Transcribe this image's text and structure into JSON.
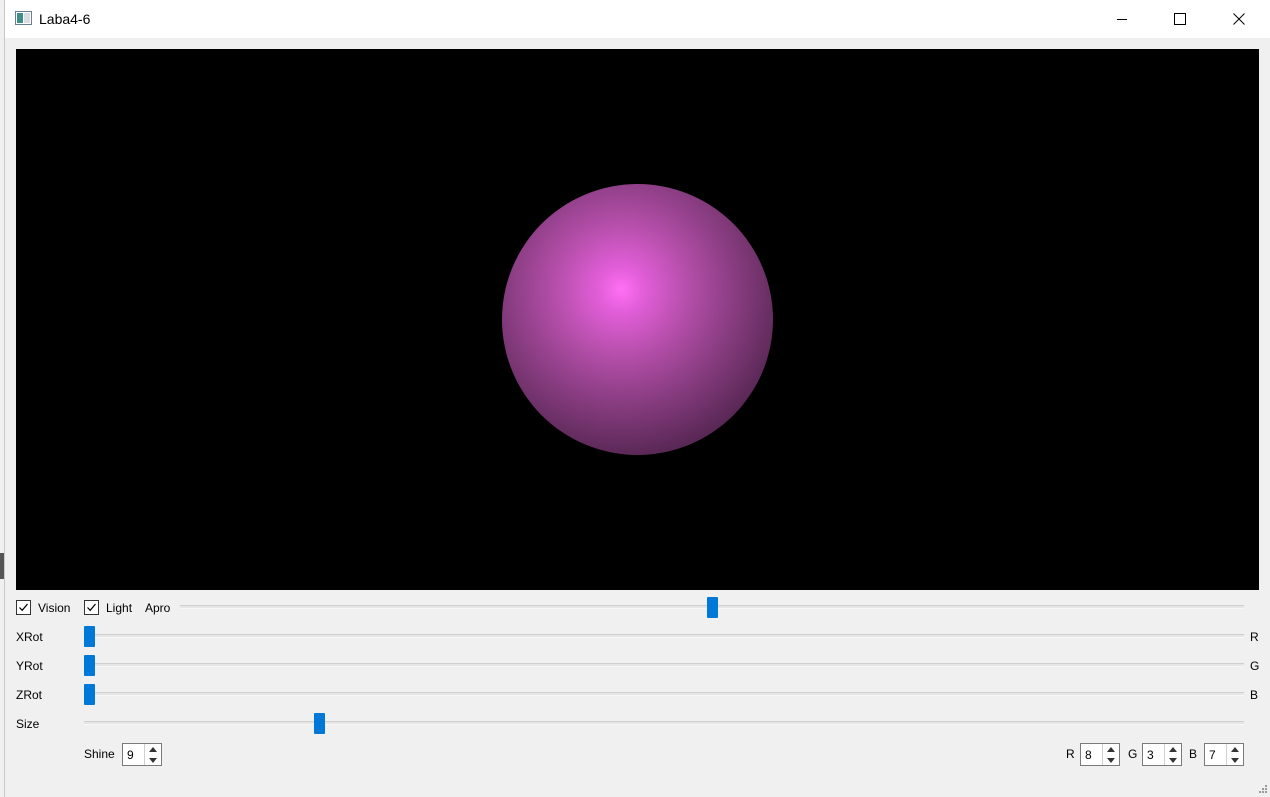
{
  "window": {
    "title": "Laba4-6"
  },
  "titlebar_icons": [
    "app-icon",
    "minimize-icon",
    "maximize-icon",
    "close-icon"
  ],
  "scene": {
    "object": "sphere",
    "colors": {
      "background": "#000000",
      "highlight": "#ff70f4",
      "shadow": "#2e1a2d"
    }
  },
  "controls": {
    "vision": {
      "label": "Vision",
      "checked": true
    },
    "light": {
      "label": "Light",
      "checked": true
    },
    "apro": {
      "label": "Apro",
      "value_fraction": 0.5
    },
    "xrot": {
      "label": "XRot",
      "value_fraction": 0.0
    },
    "yrot": {
      "label": "YRot",
      "value_fraction": 0.0
    },
    "zrot": {
      "label": "ZRot",
      "value_fraction": 0.0
    },
    "size": {
      "label": "Size",
      "value_fraction": 0.2
    },
    "side_labels": {
      "r": "R",
      "g": "G",
      "b": "B"
    },
    "shine": {
      "label": "Shine",
      "value": "9"
    },
    "color_r": {
      "label": "R",
      "value": "8"
    },
    "color_g": {
      "label": "G",
      "value": "3"
    },
    "color_b": {
      "label": "B",
      "value": "7"
    }
  },
  "accent_color": "#0078d7"
}
